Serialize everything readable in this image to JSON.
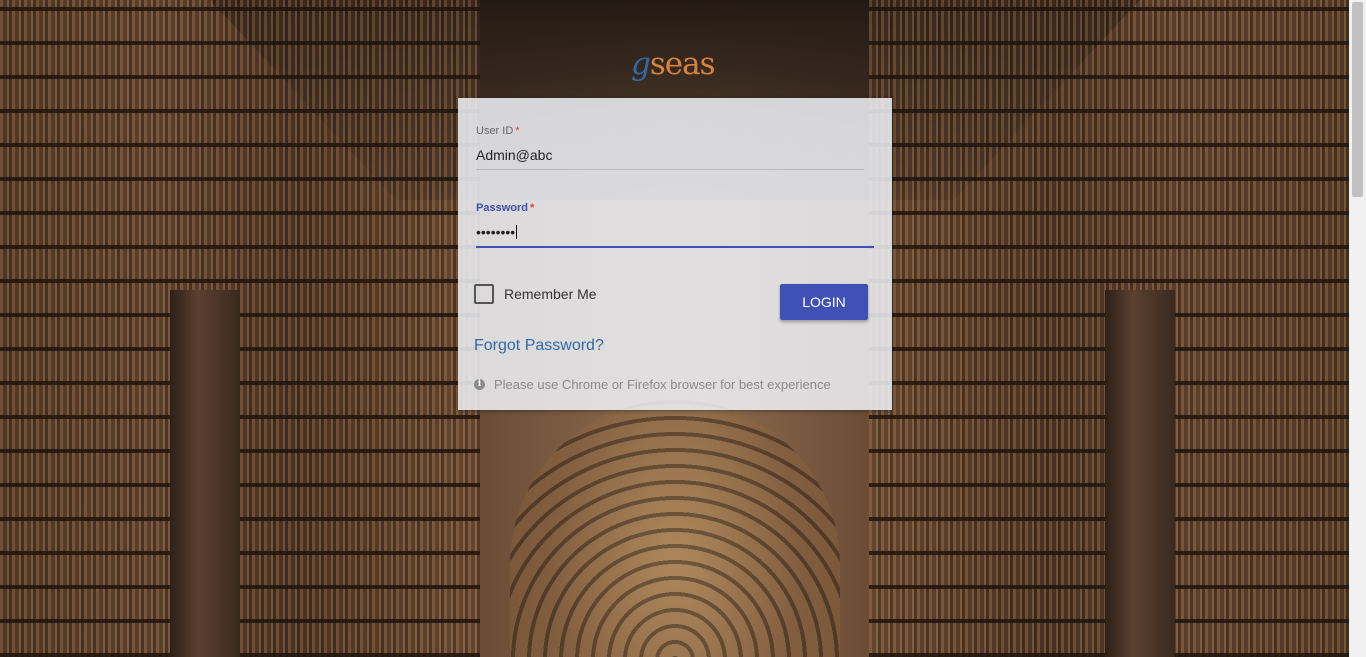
{
  "brand": {
    "logo_g": "g",
    "logo_rest": "seas",
    "logo_color": "#d8833c",
    "logo_g_color": "#2e6aa8"
  },
  "form": {
    "user_id": {
      "label": "User ID",
      "required_mark": "*",
      "value": "Admin@abc"
    },
    "password": {
      "label": "Password",
      "required_mark": "*",
      "value": "••••••••"
    },
    "remember_label": "Remember Me",
    "remember_checked": false,
    "login_label": "LOGIN",
    "forgot_label": "Forgot Password?",
    "hint": "Please use Chrome or Firefox browser for best experience",
    "info_icon": "info-circle-icon",
    "accent_color": "#3f51b5"
  }
}
